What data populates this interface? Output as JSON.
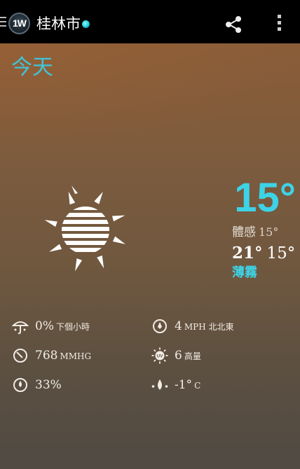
{
  "header": {
    "logo_text": "1W",
    "city": "桂林市"
  },
  "today_label": "今天",
  "current": {
    "temperature": "15°",
    "feels_label": "體感",
    "feels_value": "15°",
    "high": "21°",
    "low": "15°",
    "condition": "薄霧",
    "condition_icon": "sun-haze-icon"
  },
  "stats": {
    "precip": {
      "value": "0%",
      "unit": "下個小時",
      "icon": "umbrella-icon"
    },
    "wind": {
      "value": "4",
      "unit": "MPH 北北東",
      "icon": "wind-compass-icon"
    },
    "pressure": {
      "value": "768",
      "unit": "MMHG",
      "icon": "pressure-icon"
    },
    "uv": {
      "value": "6",
      "unit": "高量",
      "icon": "uv-sun-icon"
    },
    "humidity": {
      "value": "33%",
      "icon": "humidity-icon"
    },
    "dewpoint": {
      "value": "-1°",
      "unit": "C",
      "icon": "dewpoint-icon"
    }
  },
  "colors": {
    "accent": "#3dd3e6",
    "actionbar": "#000000"
  }
}
